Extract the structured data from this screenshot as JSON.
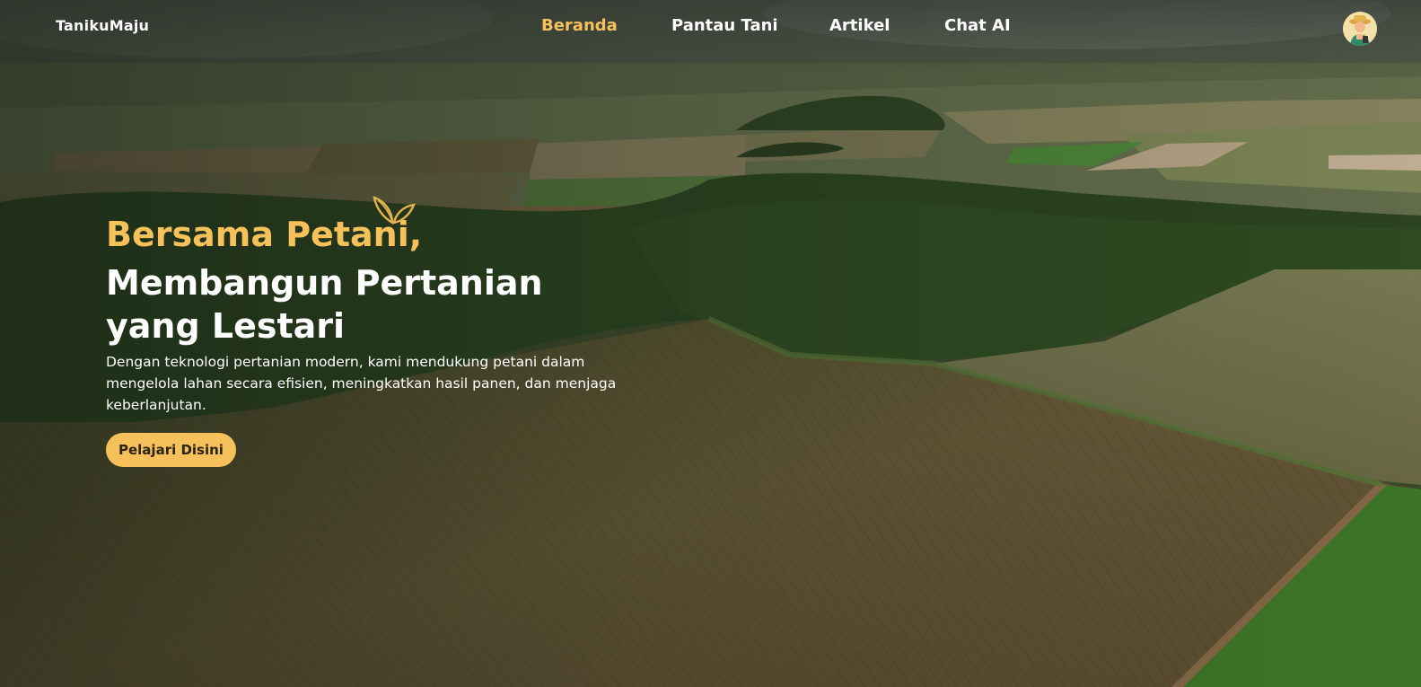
{
  "brand": {
    "logo_text": "TanikuMaju"
  },
  "nav": {
    "items": [
      {
        "label": "Beranda",
        "active": true
      },
      {
        "label": "Pantau Tani",
        "active": false
      },
      {
        "label": "Artikel",
        "active": false
      },
      {
        "label": "Chat AI",
        "active": false
      }
    ],
    "avatar_icon": "farmer-avatar-icon"
  },
  "hero": {
    "headline_accent": "Bersama Petani,",
    "headline_main": "Membangun Pertanian yang Lestari",
    "description": "Dengan teknologi pertanian modern, kami mendukung petani dalam mengelola lahan secara efisien, meningkatkan hasil panen, dan menjaga keberlanjutan.",
    "cta_label": "Pelajari Disini",
    "decor_icon": "leaf-sprout-icon"
  },
  "colors": {
    "accent": "#f6c05a",
    "text": "#ffffff",
    "button_text": "#2a2414"
  }
}
